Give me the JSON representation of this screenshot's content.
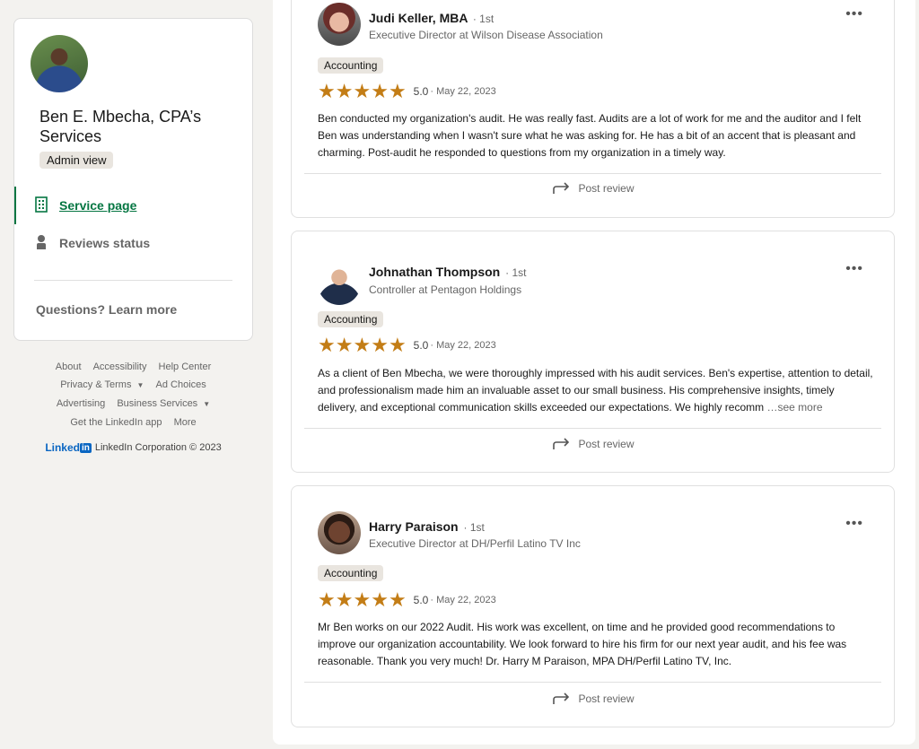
{
  "profile": {
    "name": "Ben E. Mbecha, CPA’s Services",
    "badge": "Admin view"
  },
  "nav": {
    "service_page": "Service page",
    "reviews_status": "Reviews status",
    "questions": "Questions? Learn more"
  },
  "footer": {
    "links_row1": [
      "About",
      "Accessibility",
      "Help Center"
    ],
    "links_row2": [
      "Privacy & Terms",
      "Ad Choices"
    ],
    "links_row3": [
      "Advertising",
      "Business Services"
    ],
    "links_row4": [
      "Get the LinkedIn app",
      "More"
    ],
    "logo_text": "Linked",
    "logo_in": "in",
    "copyright": "LinkedIn Corporation © 2023"
  },
  "reviews": [
    {
      "name": "Judi Keller, MBA",
      "degree": "· 1st",
      "title": "Executive Director at Wilson Disease Association",
      "tag": "Accounting",
      "rating": "5.0",
      "date": "· May 22, 2023",
      "text": "Ben conducted my organization's audit. He was really fast. Audits are a lot of work for me and the auditor and I felt Ben was understanding when I wasn't sure what he was asking for. He has a bit of an accent that is pleasant and charming. Post-audit he responded to questions from my organization in a timely way.",
      "post_label": "Post review"
    },
    {
      "name": "Johnathan Thompson",
      "degree": "· 1st",
      "title": "Controller at Pentagon Holdings",
      "tag": "Accounting",
      "rating": "5.0",
      "date": "· May 22, 2023",
      "text": "As a client of Ben Mbecha, we were thoroughly impressed with his audit services. Ben's expertise, attention to detail, and professionalism made him an invaluable asset to our small business. His comprehensive insights, timely delivery, and exceptional communication skills exceeded our expectations. We highly recomm",
      "see_more": "…see more",
      "post_label": "Post review"
    },
    {
      "name": "Harry Paraison",
      "degree": "· 1st",
      "title": "Executive Director at DH/Perfil Latino TV Inc",
      "tag": "Accounting",
      "rating": "5.0",
      "date": "· May 22, 2023",
      "text": "Mr Ben works on our 2022 Audit. His work was excellent, on time and he provided good recommendations to improve our organization accountability. We look forward to hire his firm for our next year audit, and his fee was reasonable. Thank you very much! Dr. Harry M Paraison, MPA DH/Perfil Latino TV, Inc.",
      "post_label": "Post review"
    }
  ],
  "colors": {
    "accent_green": "#057642",
    "star": "#c37d16",
    "linkedin_blue": "#0a66c2"
  }
}
